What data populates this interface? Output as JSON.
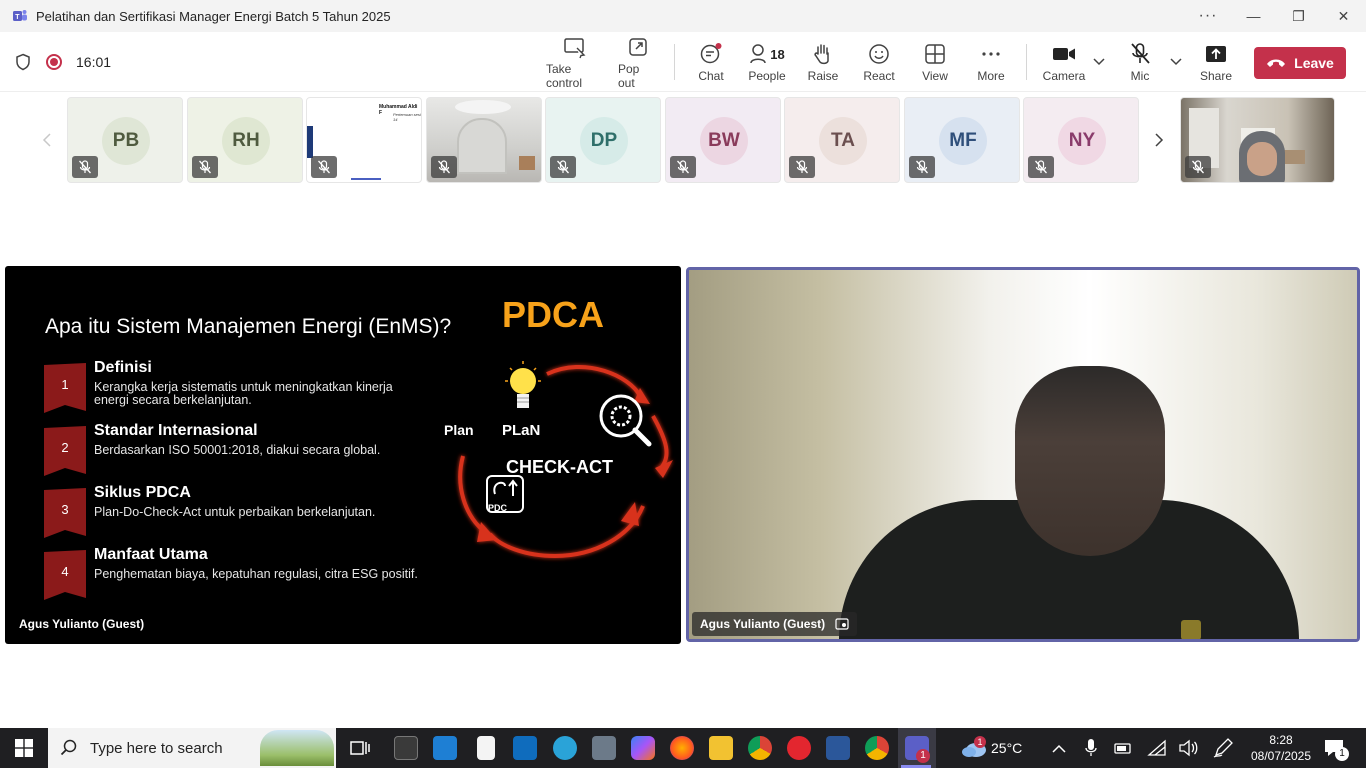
{
  "window": {
    "title": "Pelatihan dan Sertifikasi Manager Energi Batch 5 Tahun 2025",
    "more_label": "···",
    "minimize_label": "—",
    "maximize_label": "❐",
    "close_label": "✕"
  },
  "toolbar": {
    "timer": "16:01",
    "take_control": "Take control",
    "pop_out": "Pop out",
    "chat": "Chat",
    "people": "People",
    "people_count": "18",
    "raise": "Raise",
    "react": "React",
    "view": "View",
    "more": "More",
    "camera": "Camera",
    "mic": "Mic",
    "share": "Share",
    "leave": "Leave"
  },
  "participants": [
    {
      "initials": "PB",
      "bg": "#eef1ea",
      "fg": "#4f5b3f"
    },
    {
      "initials": "RH",
      "bg": "#eef2e6",
      "fg": "#4f5b3f"
    },
    {
      "initials": "DP",
      "bg": "#e8f3f1",
      "fg": "#2f6f6a"
    },
    {
      "initials": "BW",
      "bg": "#f2ebf3",
      "fg": "#8a3b5b"
    },
    {
      "initials": "TA",
      "bg": "#f5eded",
      "fg": "#6b4f4f"
    },
    {
      "initials": "MF",
      "bg": "#e9eef5",
      "fg": "#2f4f7a"
    },
    {
      "initials": "NY",
      "bg": "#f4ecf1",
      "fg": "#8a3b6b"
    }
  ],
  "thumb_slide": {
    "name": "Muhammad Aldi F",
    "sub": "Pertemuan sesi 14"
  },
  "slide": {
    "title": "Apa itu Sistem Manajemen Energi (EnMS)?",
    "pdca_title": "PDCA",
    "items": [
      {
        "num": "1",
        "head": "Definisi",
        "desc": "Kerangka kerja sistematis untuk meningkatkan kinerja energi secara berkelanjutan."
      },
      {
        "num": "2",
        "head": "Standar Internasional",
        "desc": "Berdasarkan ISO 50001:2018, diakui secara global."
      },
      {
        "num": "3",
        "head": "Siklus PDCA",
        "desc": "Plan-Do-Check-Act untuk perbaikan berkelanjutan."
      },
      {
        "num": "4",
        "head": "Manfaat Utama",
        "desc": "Penghematan biaya, kepatuhan regulasi, citra ESG positif."
      }
    ],
    "cycle_plan_left": "Plan",
    "cycle_plan_center": "PLaN",
    "cycle_check_act": "CHECK-ACT",
    "cycle_box": "PDC"
  },
  "stage": {
    "left_name": "Agus Yulianto (Guest)",
    "right_name": "Agus Yulianto (Guest)"
  },
  "taskbar": {
    "search_placeholder": "Type here to search",
    "weather": "25°C",
    "weather_badge": "1",
    "teams_badge": "1",
    "time": "8:28",
    "date": "08/07/2025",
    "notif_count": "1"
  }
}
